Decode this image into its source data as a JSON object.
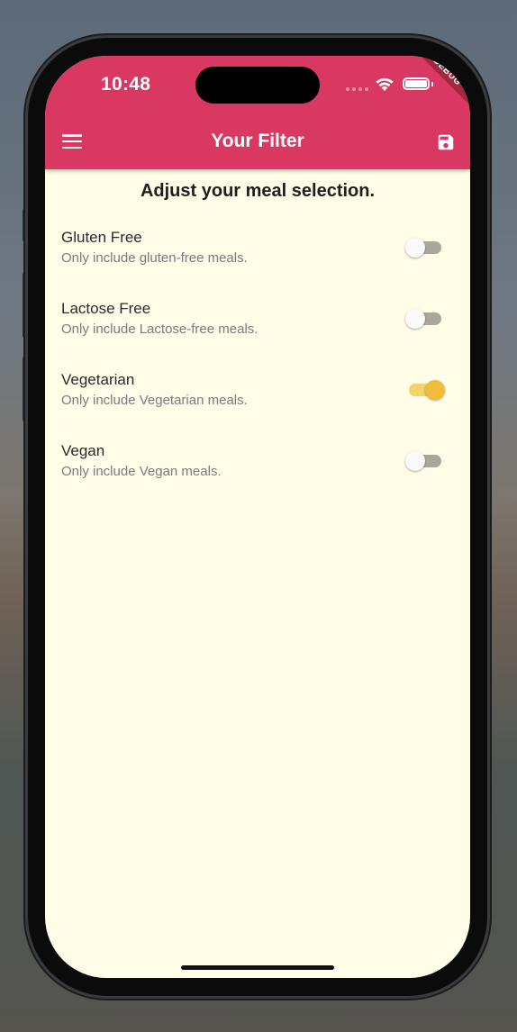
{
  "status_bar": {
    "time": "10:48",
    "debug_banner": "DEBUG"
  },
  "app_bar": {
    "title": "Your Filter",
    "menu_icon": "menu-icon",
    "save_icon": "save-icon",
    "color": "#d83862"
  },
  "page": {
    "heading": "Adjust your meal selection.",
    "background": "#fffde7"
  },
  "filters": [
    {
      "title": "Gluten Free",
      "subtitle": "Only include gluten-free meals.",
      "enabled": false
    },
    {
      "title": "Lactose Free",
      "subtitle": "Only include Lactose-free meals.",
      "enabled": false
    },
    {
      "title": "Vegetarian",
      "subtitle": "Only include Vegetarian meals.",
      "enabled": true
    },
    {
      "title": "Vegan",
      "subtitle": "Only include Vegan meals.",
      "enabled": false
    }
  ],
  "accent_color": "#f2bc3a"
}
